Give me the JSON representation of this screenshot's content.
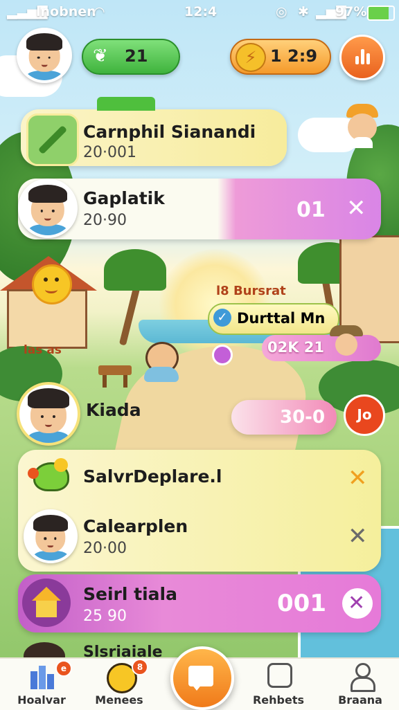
{
  "status_bar": {
    "carrier": "lnobnen",
    "time": "12:4",
    "battery": "97%"
  },
  "top_bar": {
    "coins": "21",
    "timer": "1 2:9"
  },
  "cards": [
    {
      "title": "Carnphil Sianandi",
      "subtitle": "20·001"
    },
    {
      "title": "Gaplatik",
      "subtitle": "20·90",
      "badge": "01"
    },
    {
      "title": "Kiada",
      "badge": "30-0"
    },
    {
      "title": "SalvrDeplare.l"
    },
    {
      "title": "Calearplen",
      "subtitle": "20·00"
    },
    {
      "title": "Seirl tiala",
      "subtitle": "25 90",
      "badge": "001"
    },
    {
      "title": "Slsriaiale"
    }
  ],
  "scene_labels": {
    "sign_top": "l8 Bursrat",
    "quest": "Durttal Mn",
    "score": "02K 21",
    "left_sign": "las as",
    "bubble": "Jo"
  },
  "bottom_nav": [
    {
      "label": "Hoalvar",
      "badge": "e"
    },
    {
      "label": "Menees",
      "badge": "8"
    },
    {
      "label": ""
    },
    {
      "label": "Rehbets"
    },
    {
      "label": "Braana"
    }
  ],
  "colors": {
    "accent": "#f07a1a",
    "green": "#3fb33d",
    "pink": "#e67ad8",
    "yellow": "#f8f0a8"
  }
}
